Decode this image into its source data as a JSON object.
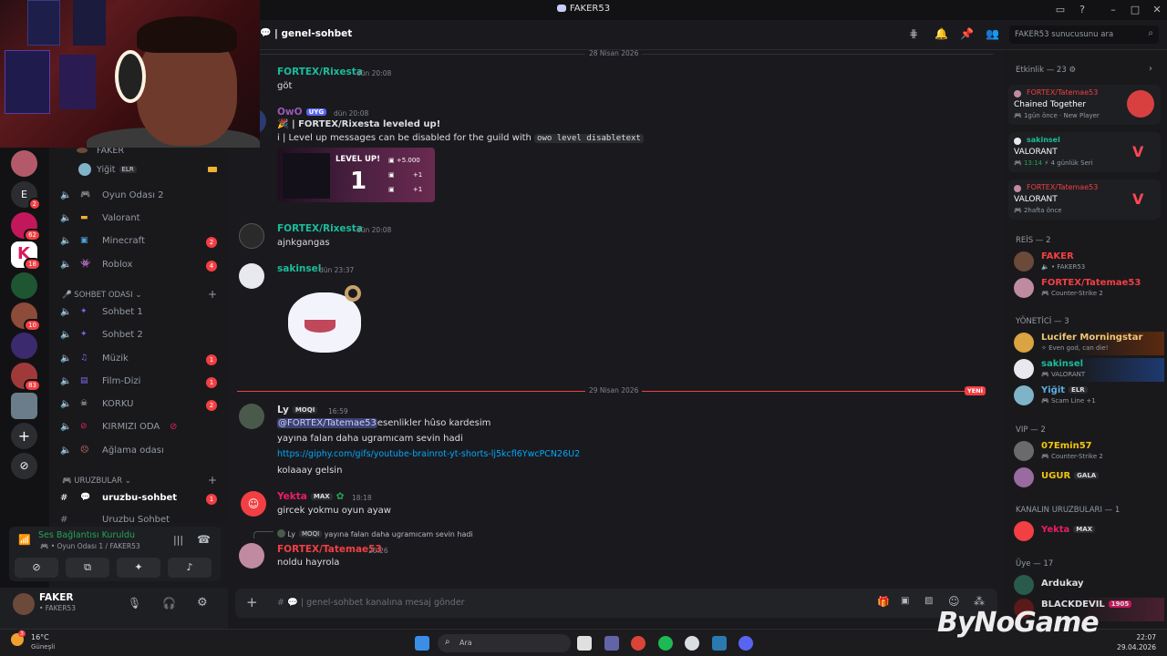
{
  "window": {
    "title": "FAKER53"
  },
  "header": {
    "channel": "genel-sohbet",
    "search_placeholder": "FAKER53 sunucusunu ara"
  },
  "servers": [
    {
      "badge": ""
    },
    {
      "label": "E",
      "badge": "2"
    },
    {
      "badge": "62"
    },
    {
      "badge": "18"
    },
    {
      "badge": ""
    },
    {
      "badge": "10"
    },
    {
      "badge": ""
    },
    {
      "badge": "83"
    },
    {
      "badge": ""
    }
  ],
  "voice_users": [
    {
      "name": "FAKER"
    },
    {
      "name": "Yiğit",
      "tag": "ELR"
    }
  ],
  "channels": [
    {
      "name": "Oyun Odası 2",
      "badge": ""
    },
    {
      "name": "Valorant",
      "badge": ""
    },
    {
      "name": "Minecraft",
      "badge": "2"
    },
    {
      "name": "Roblox",
      "badge": "4"
    },
    {
      "name": "Sohbet 1",
      "badge": ""
    },
    {
      "name": "Sohbet 2",
      "badge": ""
    },
    {
      "name": "Müzik",
      "badge": "1"
    },
    {
      "name": "Film-Dizi",
      "badge": "1"
    },
    {
      "name": "KORKU",
      "badge": "2"
    },
    {
      "name": "KIRMIZI ODA",
      "badge": ""
    },
    {
      "name": "Ağlama odası",
      "badge": ""
    }
  ],
  "categories": {
    "sohbet": "SOHBET ODASI",
    "uruzbular": "URUZBULAR"
  },
  "text_channels": [
    {
      "name": "uruzbu-sohbet",
      "badge": "1"
    },
    {
      "name": "Uruzbu Sohbet"
    }
  ],
  "voice_panel": {
    "status": "Ses Bağlantısı Kuruldu",
    "location": "Oyun Odası 1 / FAKER53"
  },
  "user": {
    "name": "FAKER",
    "sub": "• FAKER53"
  },
  "dates": {
    "d1": "28 Nisan 2026",
    "d2": "29 Nisan 2026",
    "new": "YENİ"
  },
  "messages": [
    {
      "author": "FORTEX/Rixesta",
      "time": "dün 20:08",
      "text": "göt"
    },
    {
      "author": "OwO",
      "tag": "UYG",
      "time": "dün 20:08",
      "line1": "| FORTEX/Rixesta leveled up!",
      "line2_pre": "i | Level up messages can be disabled for the guild with ",
      "line2_code": "owo level disabletext"
    },
    {
      "author": "FORTEX/Rixesta",
      "time": "dün 20:08",
      "text": "ajnkgangas"
    },
    {
      "author": "sakinsel",
      "time": "dün 23:37"
    },
    {
      "author": "Ly",
      "tag": "MOQI",
      "time": "16:59",
      "mention": "@FORTEX/Tatemae53",
      "l1": "esenlikler hûso kardesim",
      "l2": "yayına falan daha ugramıcam sevin hadi",
      "link": "https://giphy.com/gifs/youtube-brainrot-yt-shorts-lj5kcfl6YwcPCN26U2",
      "l3": "kolaaay gelsin"
    },
    {
      "author": "Yekta",
      "tag": "MAX",
      "time": "18:18",
      "text": "gircek yokmu oyun ayaw"
    },
    {
      "reply_author": "Ly",
      "reply_tag": "MOQI",
      "reply_text": "yayına falan daha ugramıcam sevin hadi",
      "author": "FORTEX/Tatemae53",
      "time": "20:26",
      "text": "noldu hayrola"
    }
  ],
  "levelup": {
    "title": "LEVEL UP!",
    "level": "1",
    "r1": "+5.000",
    "r2": "+1",
    "r3": "+1"
  },
  "composer": {
    "placeholder": "genel-sohbet kanalına mesaj gönder"
  },
  "activity": {
    "header": "Etkinlik — 23",
    "cards": [
      {
        "user": "FORTEX/Tatemae53",
        "game": "Chained Together",
        "meta": "1gün önce",
        "meta2": "New Player"
      },
      {
        "user": "sakinsel",
        "game": "VALORANT",
        "meta": "13:14",
        "meta2": "4 günlük Seri"
      },
      {
        "user": "FORTEX/Tatemae53",
        "game": "VALORANT",
        "meta": "2hafta önce"
      }
    ]
  },
  "member_sections": [
    {
      "title": "REİS — 2",
      "members": [
        {
          "name": "FAKER",
          "sub": "• FAKER53",
          "color": "#f23f43"
        },
        {
          "name": "FORTEX/Tatemae53",
          "sub": "Counter-Strike 2",
          "color": "#f23f43"
        }
      ]
    },
    {
      "title": "YÖNETİCİ — 3",
      "members": [
        {
          "name": "Lucifer Morningstar",
          "sub": "Even god, can die!",
          "color": "#f0c674"
        },
        {
          "name": "sakinsel",
          "sub": "VALORANT",
          "color": "#1abc9c"
        },
        {
          "name": "Yiğit",
          "tag": "ELR",
          "sub": "Scam Line +1",
          "color": "#5dade2"
        }
      ]
    },
    {
      "title": "VIP — 2",
      "members": [
        {
          "name": "07Emin57",
          "sub": "Counter-Strike 2",
          "color": "#f1c40f"
        },
        {
          "name": "UGUR",
          "tag": "GALA",
          "sub": "",
          "color": "#f1c40f"
        }
      ]
    },
    {
      "title": "KANALIN URUZBULARI — 1",
      "members": [
        {
          "name": "Yekta",
          "tag": "MAX",
          "sub": "",
          "color": "#e91e63"
        }
      ]
    },
    {
      "title": "Üye — 17",
      "members": [
        {
          "name": "Ardukay",
          "sub": "",
          "color": "#dbdee1"
        },
        {
          "name": "BLACKDEVIL",
          "tag": "1905",
          "sub": "",
          "color": "#dbdee1"
        }
      ]
    }
  ],
  "taskbar": {
    "weather_temp": "16°C",
    "weather_desc": "Güneşli",
    "weather_badge": "3",
    "search": "Ara",
    "time": "22:07",
    "date": "29.04.2026"
  },
  "watermark": "ByNoGame"
}
